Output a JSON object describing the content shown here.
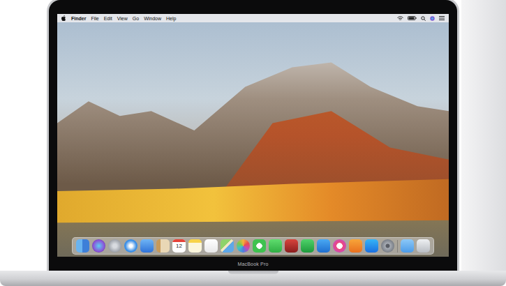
{
  "menu_bar": {
    "app": "Finder",
    "items": [
      "File",
      "Edit",
      "View",
      "Go",
      "Window",
      "Help"
    ]
  },
  "dock": {
    "calendar_date": "12"
  },
  "device": {
    "label": "MacBook Pro"
  }
}
